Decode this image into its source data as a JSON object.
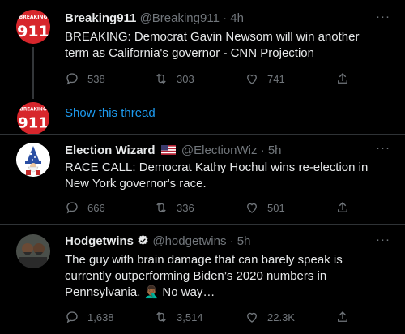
{
  "tweets": [
    {
      "name": "Breaking911",
      "handle": "@Breaking911",
      "time": "· 4h",
      "text": "BREAKING: Democrat Gavin Newsom will win another term as California's governor - CNN Projection",
      "replies": "538",
      "retweets": "303",
      "likes": "741",
      "avatar_text": "911",
      "avatar_top": "BREAKING"
    },
    {
      "name": "Election Wizard",
      "handle": "@ElectionWiz",
      "time": "· 5h",
      "text": "RACE CALL: Democrat Kathy Hochul wins re-election in New York governor's race.",
      "replies": "666",
      "retweets": "336",
      "likes": "501"
    },
    {
      "name": "Hodgetwins",
      "handle": "@hodgetwins",
      "time": "· 5h",
      "text": "The guy with brain damage that can barely speak is currently outperforming Biden’s 2020 numbers in Pennsylvania. 🤦🏾‍♂️ No way…",
      "replies": "1,638",
      "retweets": "3,514",
      "likes": "22.3K"
    }
  ],
  "thread": {
    "show_thread": "Show this thread",
    "avatar_text": "911",
    "avatar_top": "BREAKING"
  },
  "more_label": "···",
  "colors": {
    "background": "#000000",
    "link": "#1d9bf0",
    "muted": "#71767b",
    "breaking_red": "#d7262c"
  },
  "icons": [
    "reply-icon",
    "retweet-icon",
    "like-icon",
    "share-icon",
    "more-icon",
    "verified-icon",
    "us-flag-icon"
  ]
}
